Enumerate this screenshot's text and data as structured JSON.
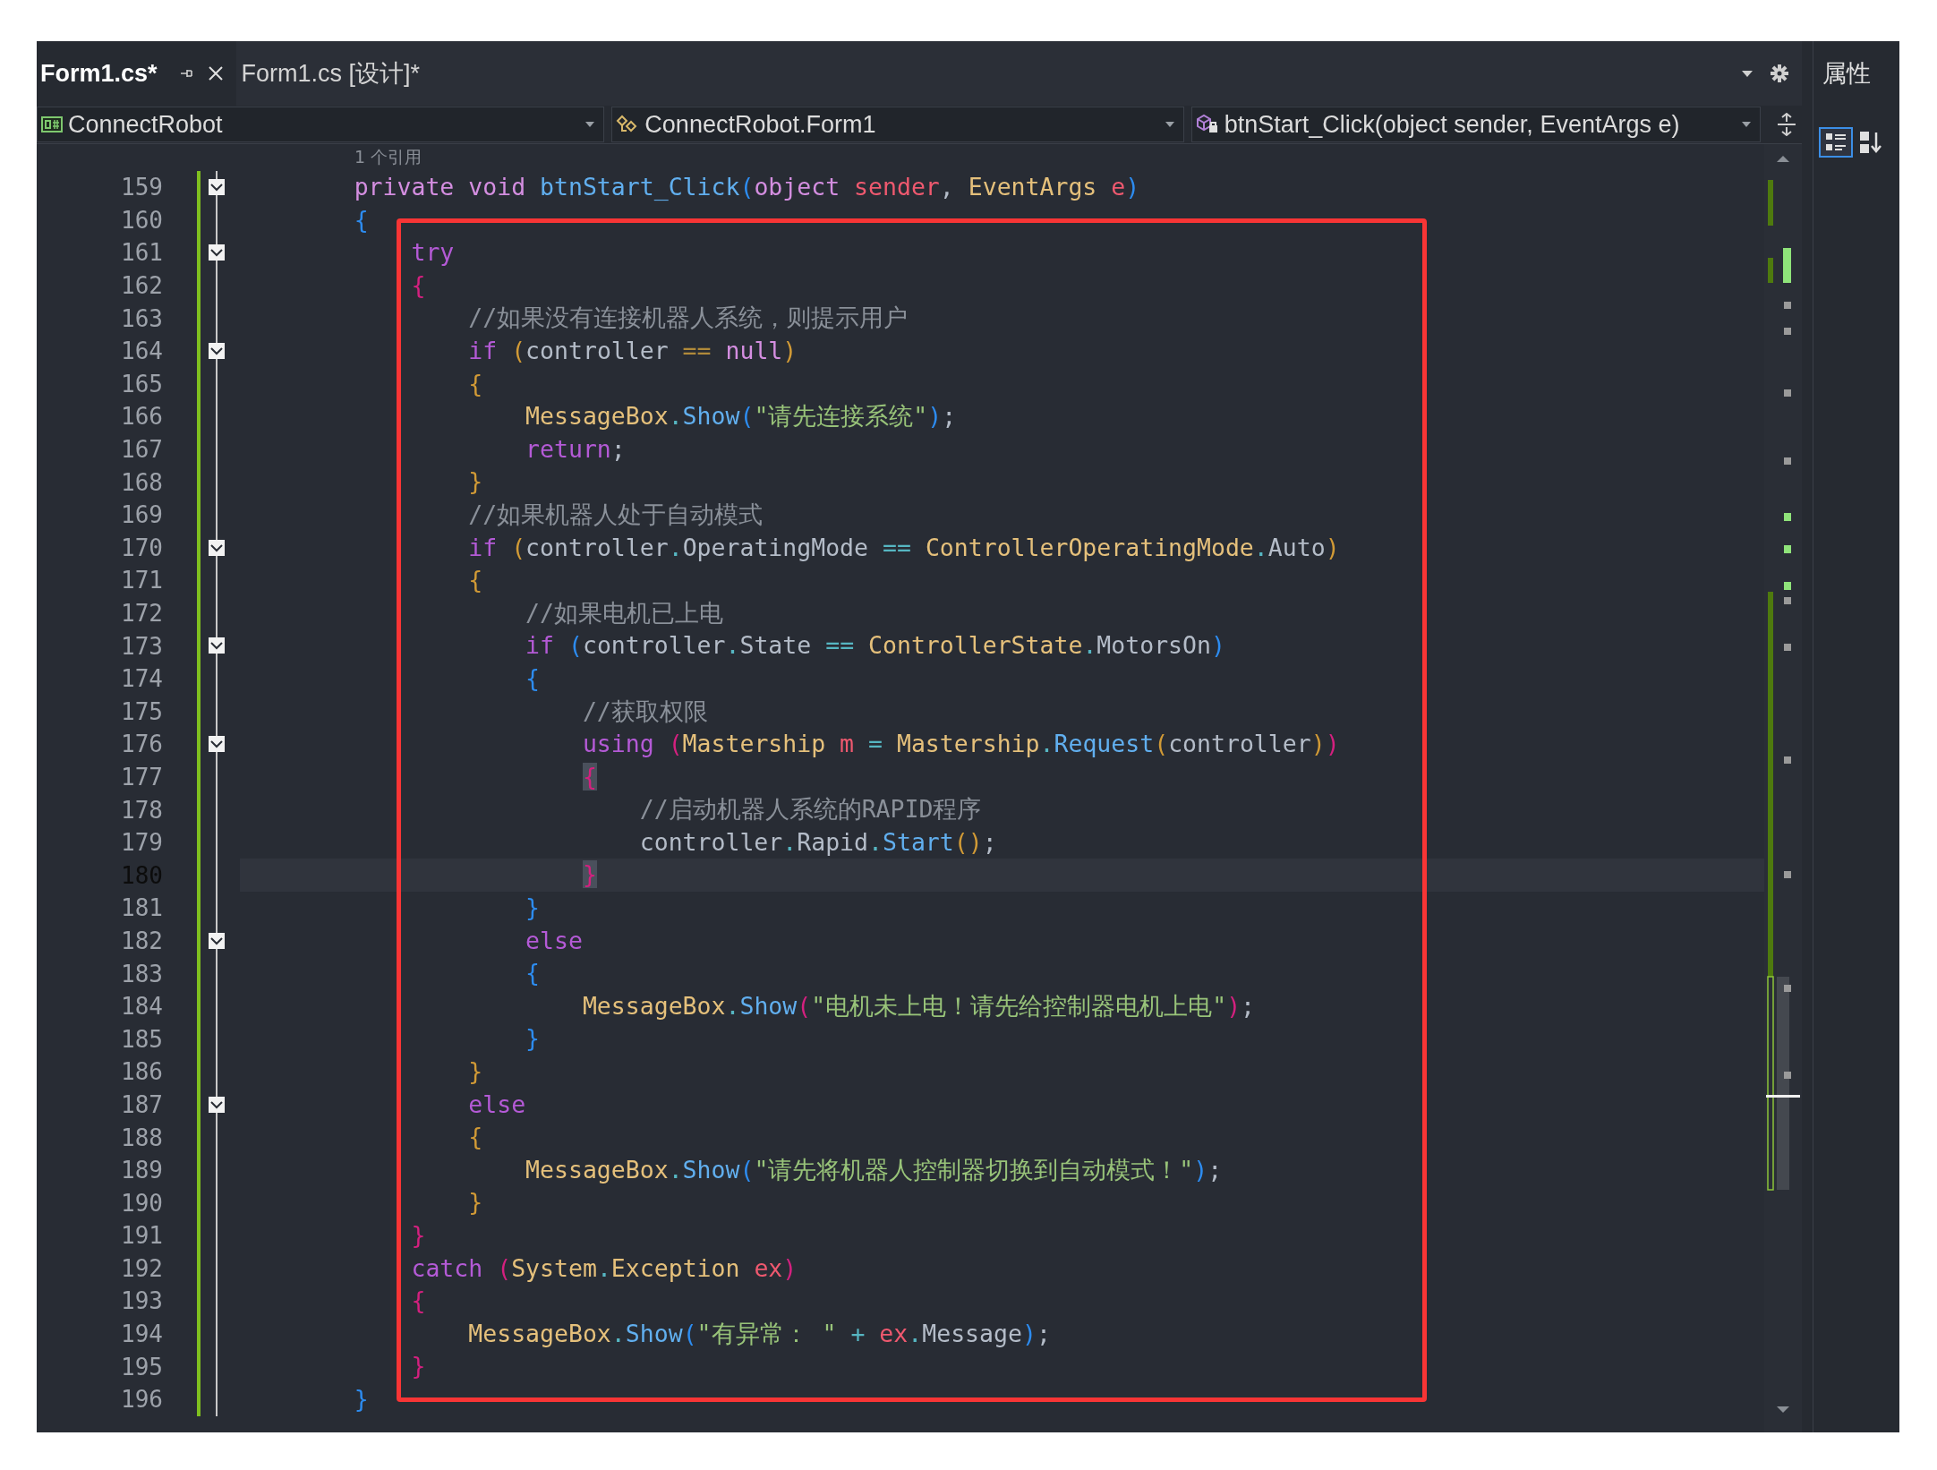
{
  "tabs": [
    {
      "label": "Form1.cs*",
      "selected": true
    },
    {
      "label": "Form1.cs [设计]*",
      "selected": false
    }
  ],
  "properties_panel": {
    "title": "属性"
  },
  "navigation_bar": [
    {
      "kind": "project",
      "label": "ConnectRobot"
    },
    {
      "kind": "class",
      "label": "ConnectRobot.Form1"
    },
    {
      "kind": "method",
      "label": "btnStart_Click(object sender, EventArgs e)"
    }
  ],
  "editor": {
    "code_lens": "1 个引用",
    "lines": [
      {
        "n": "159",
        "fold": true,
        "current": false,
        "tokens": [
          {
            "kind": "kw",
            "text": "        private void "
          },
          {
            "kind": "method",
            "text": "btnStart_Click"
          },
          {
            "kind": "b3",
            "text": "("
          },
          {
            "kind": "kw",
            "text": "object "
          },
          {
            "kind": "param",
            "text": "sender"
          },
          {
            "kind": "id",
            "text": ", "
          },
          {
            "kind": "type",
            "text": "EventArgs "
          },
          {
            "kind": "param",
            "text": "e"
          },
          {
            "kind": "b3",
            "text": ")"
          }
        ]
      },
      {
        "n": "160",
        "fold": false,
        "current": false,
        "tokens": [
          {
            "kind": "b3",
            "text": "        {"
          }
        ]
      },
      {
        "n": "161",
        "fold": true,
        "current": false,
        "tokens": [
          {
            "kind": "ctl",
            "text": "            try"
          }
        ]
      },
      {
        "n": "162",
        "fold": false,
        "current": false,
        "tokens": [
          {
            "kind": "b2",
            "text": "            {"
          }
        ]
      },
      {
        "n": "163",
        "fold": false,
        "current": false,
        "tokens": [
          {
            "kind": "cmt",
            "text": "                //如果没有连接机器人系统，则提示用户"
          }
        ]
      },
      {
        "n": "164",
        "fold": true,
        "current": false,
        "tokens": [
          {
            "kind": "ctl",
            "text": "                if "
          },
          {
            "kind": "b1",
            "text": "("
          },
          {
            "kind": "id",
            "text": "controller "
          },
          {
            "kind": "op1",
            "text": "== "
          },
          {
            "kind": "kw",
            "text": "null"
          },
          {
            "kind": "b1",
            "text": ")"
          }
        ]
      },
      {
        "n": "165",
        "fold": false,
        "current": false,
        "tokens": [
          {
            "kind": "b1",
            "text": "                {"
          }
        ]
      },
      {
        "n": "166",
        "fold": false,
        "current": false,
        "tokens": [
          {
            "kind": "type",
            "text": "                    MessageBox"
          },
          {
            "kind": "op",
            "text": "."
          },
          {
            "kind": "method",
            "text": "Show"
          },
          {
            "kind": "b3",
            "text": "("
          },
          {
            "kind": "str",
            "text": "\"请先连接系统\""
          },
          {
            "kind": "b3",
            "text": ")"
          },
          {
            "kind": "id",
            "text": ";"
          }
        ]
      },
      {
        "n": "167",
        "fold": false,
        "current": false,
        "tokens": [
          {
            "kind": "ctl",
            "text": "                    return"
          },
          {
            "kind": "id",
            "text": ";"
          }
        ]
      },
      {
        "n": "168",
        "fold": false,
        "current": false,
        "tokens": [
          {
            "kind": "b1",
            "text": "                }"
          }
        ]
      },
      {
        "n": "169",
        "fold": false,
        "current": false,
        "tokens": [
          {
            "kind": "cmt",
            "text": "                //如果机器人处于自动模式"
          }
        ]
      },
      {
        "n": "170",
        "fold": true,
        "current": false,
        "tokens": [
          {
            "kind": "ctl",
            "text": "                if "
          },
          {
            "kind": "b1",
            "text": "("
          },
          {
            "kind": "id",
            "text": "controller"
          },
          {
            "kind": "op",
            "text": "."
          },
          {
            "kind": "id",
            "text": "OperatingMode "
          },
          {
            "kind": "op",
            "text": "== "
          },
          {
            "kind": "type",
            "text": "ControllerOperatingMode"
          },
          {
            "kind": "op",
            "text": "."
          },
          {
            "kind": "id",
            "text": "Auto"
          },
          {
            "kind": "b1",
            "text": ")"
          }
        ]
      },
      {
        "n": "171",
        "fold": false,
        "current": false,
        "tokens": [
          {
            "kind": "b1",
            "text": "                {"
          }
        ]
      },
      {
        "n": "172",
        "fold": false,
        "current": false,
        "tokens": [
          {
            "kind": "cmt",
            "text": "                    //如果电机已上电"
          }
        ]
      },
      {
        "n": "173",
        "fold": true,
        "current": false,
        "tokens": [
          {
            "kind": "ctl",
            "text": "                    if "
          },
          {
            "kind": "b3",
            "text": "("
          },
          {
            "kind": "id",
            "text": "controller"
          },
          {
            "kind": "op",
            "text": "."
          },
          {
            "kind": "id",
            "text": "State "
          },
          {
            "kind": "op",
            "text": "== "
          },
          {
            "kind": "type",
            "text": "ControllerState"
          },
          {
            "kind": "op",
            "text": "."
          },
          {
            "kind": "id",
            "text": "MotorsOn"
          },
          {
            "kind": "b3",
            "text": ")"
          }
        ]
      },
      {
        "n": "174",
        "fold": false,
        "current": false,
        "tokens": [
          {
            "kind": "b3",
            "text": "                    {"
          }
        ]
      },
      {
        "n": "175",
        "fold": false,
        "current": false,
        "tokens": [
          {
            "kind": "cmt",
            "text": "                        //获取权限"
          }
        ]
      },
      {
        "n": "176",
        "fold": true,
        "current": false,
        "tokens": [
          {
            "kind": "ctl",
            "text": "                        using "
          },
          {
            "kind": "b2",
            "text": "("
          },
          {
            "kind": "type",
            "text": "Mastership "
          },
          {
            "kind": "param",
            "text": "m "
          },
          {
            "kind": "op",
            "text": "= "
          },
          {
            "kind": "type",
            "text": "Mastership"
          },
          {
            "kind": "op",
            "text": "."
          },
          {
            "kind": "method",
            "text": "Request"
          },
          {
            "kind": "b1",
            "text": "("
          },
          {
            "kind": "id",
            "text": "controller"
          },
          {
            "kind": "b1",
            "text": ")"
          },
          {
            "kind": "b2",
            "text": ")"
          }
        ]
      },
      {
        "n": "177",
        "fold": false,
        "current": false,
        "tokens": [
          {
            "kind": "b2match",
            "text": "                        {"
          }
        ]
      },
      {
        "n": "178",
        "fold": false,
        "current": false,
        "tokens": [
          {
            "kind": "cmt",
            "text": "                            //启动机器人系统的RAPID程序"
          }
        ]
      },
      {
        "n": "179",
        "fold": false,
        "current": false,
        "tokens": [
          {
            "kind": "id",
            "text": "                            controller"
          },
          {
            "kind": "op",
            "text": "."
          },
          {
            "kind": "id",
            "text": "Rapid"
          },
          {
            "kind": "op",
            "text": "."
          },
          {
            "kind": "method",
            "text": "Start"
          },
          {
            "kind": "b1",
            "text": "()"
          },
          {
            "kind": "id",
            "text": ";"
          }
        ]
      },
      {
        "n": "180",
        "fold": false,
        "current": true,
        "tokens": [
          {
            "kind": "b2match",
            "text": "                        }"
          }
        ]
      },
      {
        "n": "181",
        "fold": false,
        "current": false,
        "tokens": [
          {
            "kind": "b3",
            "text": "                    }"
          }
        ]
      },
      {
        "n": "182",
        "fold": true,
        "current": false,
        "tokens": [
          {
            "kind": "ctl",
            "text": "                    else"
          }
        ]
      },
      {
        "n": "183",
        "fold": false,
        "current": false,
        "tokens": [
          {
            "kind": "b3",
            "text": "                    {"
          }
        ]
      },
      {
        "n": "184",
        "fold": false,
        "current": false,
        "tokens": [
          {
            "kind": "type",
            "text": "                        MessageBox"
          },
          {
            "kind": "op",
            "text": "."
          },
          {
            "kind": "method",
            "text": "Show"
          },
          {
            "kind": "b2",
            "text": "("
          },
          {
            "kind": "str",
            "text": "\"电机未上电！请先给控制器电机上电\""
          },
          {
            "kind": "b2",
            "text": ")"
          },
          {
            "kind": "id",
            "text": ";"
          }
        ]
      },
      {
        "n": "185",
        "fold": false,
        "current": false,
        "tokens": [
          {
            "kind": "b3",
            "text": "                    }"
          }
        ]
      },
      {
        "n": "186",
        "fold": false,
        "current": false,
        "tokens": [
          {
            "kind": "b1",
            "text": "                }"
          }
        ]
      },
      {
        "n": "187",
        "fold": true,
        "current": false,
        "tokens": [
          {
            "kind": "ctl",
            "text": "                else"
          }
        ]
      },
      {
        "n": "188",
        "fold": false,
        "current": false,
        "tokens": [
          {
            "kind": "b1",
            "text": "                {"
          }
        ]
      },
      {
        "n": "189",
        "fold": false,
        "current": false,
        "tokens": [
          {
            "kind": "type",
            "text": "                    MessageBox"
          },
          {
            "kind": "op",
            "text": "."
          },
          {
            "kind": "method",
            "text": "Show"
          },
          {
            "kind": "b3",
            "text": "("
          },
          {
            "kind": "str",
            "text": "\"请先将机器人控制器切换到自动模式！\""
          },
          {
            "kind": "b3",
            "text": ")"
          },
          {
            "kind": "id",
            "text": ";"
          }
        ]
      },
      {
        "n": "190",
        "fold": false,
        "current": false,
        "tokens": [
          {
            "kind": "b1",
            "text": "                }"
          }
        ]
      },
      {
        "n": "191",
        "fold": false,
        "current": false,
        "tokens": [
          {
            "kind": "b2",
            "text": "            }"
          }
        ]
      },
      {
        "n": "192",
        "fold": false,
        "current": false,
        "tokens": [
          {
            "kind": "ctl",
            "text": "            catch "
          },
          {
            "kind": "b2",
            "text": "("
          },
          {
            "kind": "type",
            "text": "System"
          },
          {
            "kind": "op",
            "text": "."
          },
          {
            "kind": "type",
            "text": "Exception "
          },
          {
            "kind": "param",
            "text": "ex"
          },
          {
            "kind": "b2",
            "text": ")"
          }
        ]
      },
      {
        "n": "193",
        "fold": false,
        "current": false,
        "tokens": [
          {
            "kind": "b2",
            "text": "            {"
          }
        ]
      },
      {
        "n": "194",
        "fold": false,
        "current": false,
        "tokens": [
          {
            "kind": "type",
            "text": "                MessageBox"
          },
          {
            "kind": "op",
            "text": "."
          },
          {
            "kind": "method",
            "text": "Show"
          },
          {
            "kind": "b3",
            "text": "("
          },
          {
            "kind": "str",
            "text": "\"有异常： \" "
          },
          {
            "kind": "op",
            "text": "+ "
          },
          {
            "kind": "param",
            "text": "ex"
          },
          {
            "kind": "op",
            "text": "."
          },
          {
            "kind": "id",
            "text": "Message"
          },
          {
            "kind": "b3",
            "text": ")"
          },
          {
            "kind": "id",
            "text": ";"
          }
        ]
      },
      {
        "n": "195",
        "fold": false,
        "current": false,
        "tokens": [
          {
            "kind": "b2",
            "text": "            }"
          }
        ]
      },
      {
        "n": "196",
        "fold": false,
        "current": false,
        "tokens": [
          {
            "kind": "b3",
            "text": "        }"
          }
        ]
      }
    ]
  }
}
